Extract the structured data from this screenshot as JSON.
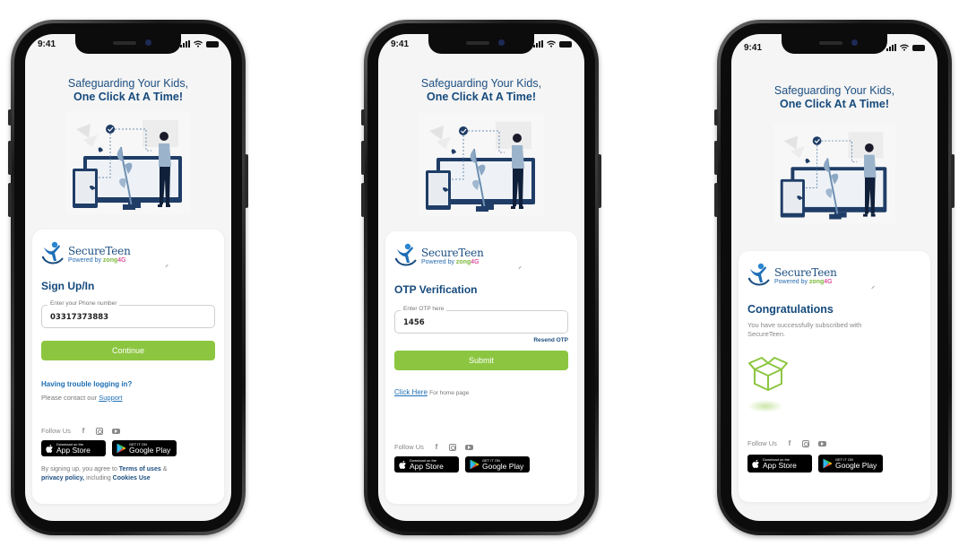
{
  "common": {
    "status_time": "9:41",
    "tagline_line1": "Safeguarding Your Kids,",
    "tagline_line2": "One Click At A Time!",
    "brand_name": "SecureTeen",
    "powered_by": "Powered by",
    "partner": "zong",
    "partner_suffix": "4G",
    "follow_us": "Follow Us",
    "social_icons": [
      "facebook-icon",
      "instagram-icon",
      "youtube-icon"
    ],
    "appstore_small": "Download on the",
    "appstore_big": "App Store",
    "googleplay_small": "GET IT ON",
    "googleplay_big": "Google Play",
    "colors": {
      "primary_blue": "#154a7c",
      "link_blue": "#1d6fb5",
      "accent_green": "#8cc641"
    }
  },
  "screens": [
    {
      "id": "sign-in",
      "title": "Sign Up/In",
      "phone_field": {
        "label": "Enter your Phone number",
        "value": "03317373883"
      },
      "continue_label": "Continue",
      "trouble_label": "Having trouble logging in?",
      "contact_prefix": "Please contact our",
      "support_link": "Support",
      "terms": {
        "prefix": "By signing up, you agree to",
        "terms_link": "Terms of uses",
        "amp": "&",
        "privacy_link": "privacy policy,",
        "including": "including",
        "cookies_link": "Cookies Use"
      }
    },
    {
      "id": "otp",
      "title": "OTP Verification",
      "otp_field": {
        "label": "Enter OTP here",
        "value": "1456"
      },
      "resend_label": "Resend OTP",
      "submit_label": "Submit",
      "click_here": "Click Here",
      "home_hint": "For home page"
    },
    {
      "id": "congrats",
      "title": "Congratulations",
      "message": "You have successfully subscribed with SecureTeen."
    }
  ]
}
